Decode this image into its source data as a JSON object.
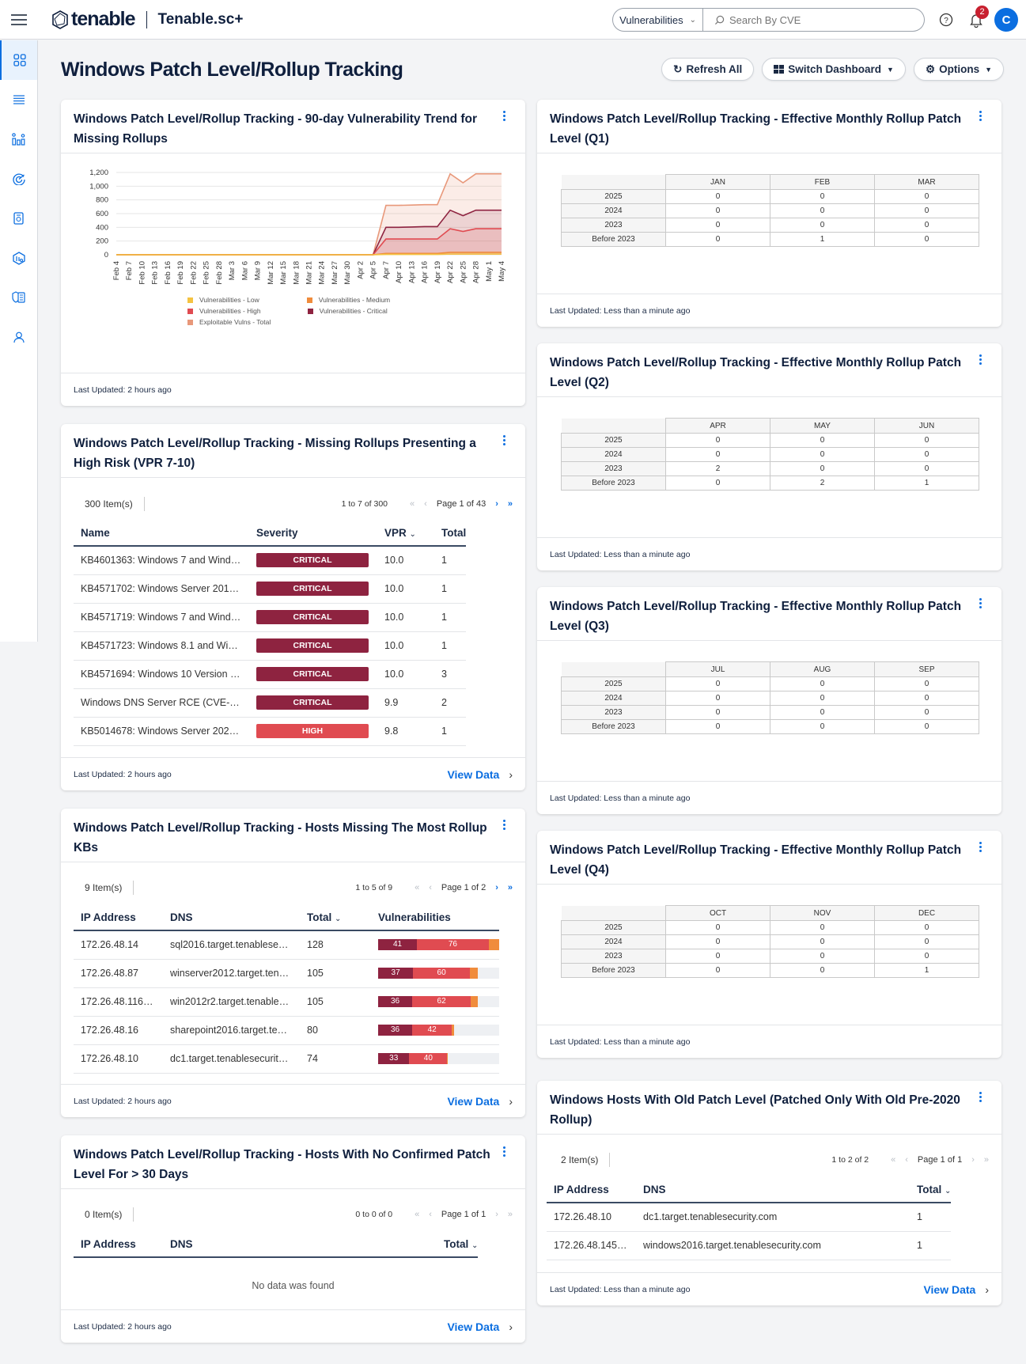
{
  "topbar": {
    "brand": "tenable",
    "app_name": "Tenable.sc+",
    "context_select": "Vulnerabilities",
    "search_placeholder": "Search By CVE",
    "notification_count": "2",
    "user_initial": "C"
  },
  "sidebar": {
    "items": [
      {
        "icon": "dashboard-grid-icon",
        "active": true
      },
      {
        "icon": "list-icon"
      },
      {
        "icon": "analytics-icon"
      },
      {
        "icon": "scan-target-icon"
      },
      {
        "icon": "report-icon"
      },
      {
        "icon": "assets-icon"
      },
      {
        "icon": "policy-shield-icon"
      },
      {
        "icon": "user-icon"
      }
    ]
  },
  "page": {
    "title": "Windows Patch Level/Rollup Tracking",
    "buttons": {
      "refresh": "Refresh All",
      "switch": "Switch Dashboard",
      "options": "Options"
    }
  },
  "trend_card": {
    "title": "Windows Patch Level/Rollup Tracking - 90-day Vulnerability Trend for Missing Rollups",
    "footer": "Last Updated: 2 hours ago"
  },
  "chart_data": {
    "type": "area",
    "title": "Windows Patch Level/Rollup Tracking - 90-day Vulnerability Trend for Missing Rollups",
    "xlabel": "",
    "ylabel": "",
    "ylim": [
      0,
      1200
    ],
    "yticks": [
      "0",
      "200",
      "400",
      "600",
      "800",
      "1,000",
      "1,200"
    ],
    "ytick_values": [
      0,
      200,
      400,
      600,
      800,
      1000,
      1200
    ],
    "x": [
      "Feb 4",
      "Feb 7",
      "Feb 10",
      "Feb 13",
      "Feb 16",
      "Feb 19",
      "Feb 22",
      "Feb 25",
      "Feb 28",
      "Mar 3",
      "Mar 6",
      "Mar 9",
      "Mar 12",
      "Mar 15",
      "Mar 18",
      "Mar 21",
      "Mar 24",
      "Mar 27",
      "Mar 30",
      "Apr 2",
      "Apr 5",
      "Apr 7",
      "Apr 10",
      "Apr 13",
      "Apr 16",
      "Apr 19",
      "Apr 22",
      "Apr 25",
      "Apr 28",
      "May 1",
      "May 4"
    ],
    "grid": true,
    "legend_position": "bottom",
    "series": [
      {
        "name": "Vulnerabilities - Low",
        "color": "#f5c342",
        "values": [
          0,
          0,
          0,
          0,
          0,
          0,
          0,
          0,
          0,
          0,
          0,
          0,
          0,
          0,
          0,
          0,
          0,
          0,
          0,
          0,
          0,
          5,
          5,
          5,
          5,
          5,
          10,
          10,
          10,
          10,
          10
        ]
      },
      {
        "name": "Vulnerabilities - Medium",
        "color": "#f08c3c",
        "values": [
          0,
          0,
          0,
          0,
          0,
          0,
          0,
          0,
          0,
          0,
          0,
          0,
          0,
          0,
          0,
          0,
          0,
          0,
          0,
          0,
          0,
          20,
          20,
          20,
          20,
          20,
          35,
          35,
          35,
          35,
          35
        ]
      },
      {
        "name": "Vulnerabilities - High",
        "color": "#e04b51",
        "values": [
          0,
          0,
          0,
          0,
          0,
          0,
          0,
          0,
          0,
          0,
          0,
          0,
          0,
          0,
          0,
          0,
          0,
          0,
          0,
          0,
          0,
          230,
          230,
          230,
          230,
          230,
          380,
          340,
          380,
          380,
          380
        ]
      },
      {
        "name": "Vulnerabilities - Critical",
        "color": "#8e2340",
        "values": [
          0,
          0,
          0,
          0,
          0,
          0,
          0,
          0,
          0,
          0,
          0,
          0,
          0,
          0,
          0,
          0,
          0,
          0,
          0,
          0,
          0,
          400,
          400,
          405,
          410,
          410,
          650,
          570,
          650,
          650,
          650
        ]
      },
      {
        "name": "Exploitable Vulns - Total",
        "color": "#e8987a",
        "values": [
          0,
          0,
          0,
          0,
          0,
          0,
          0,
          0,
          0,
          0,
          0,
          0,
          0,
          0,
          0,
          0,
          0,
          0,
          0,
          0,
          0,
          720,
          720,
          725,
          730,
          730,
          1180,
          1050,
          1180,
          1180,
          1180
        ]
      }
    ]
  },
  "missing_rollups": {
    "title": "Windows Patch Level/Rollup Tracking - Missing Rollups Presenting a High Risk (VPR 7-10)",
    "items": "300 Item(s)",
    "range": "1 to 7 of 300",
    "page": "Page 1 of 43",
    "columns": [
      "Name",
      "Severity",
      "VPR",
      "Total"
    ],
    "rows": [
      {
        "name": "KB4601363: Windows 7 and Wind…",
        "severity": "CRITICAL",
        "vpr": "10.0",
        "total": "1"
      },
      {
        "name": "KB4571702: Windows Server 201…",
        "severity": "CRITICAL",
        "vpr": "10.0",
        "total": "1"
      },
      {
        "name": "KB4571719: Windows 7 and Wind…",
        "severity": "CRITICAL",
        "vpr": "10.0",
        "total": "1"
      },
      {
        "name": "KB4571723: Windows 8.1 and Wi…",
        "severity": "CRITICAL",
        "vpr": "10.0",
        "total": "1"
      },
      {
        "name": "KB4571694: Windows 10 Version …",
        "severity": "CRITICAL",
        "vpr": "10.0",
        "total": "3"
      },
      {
        "name": "Windows DNS Server RCE (CVE-…",
        "severity": "CRITICAL",
        "vpr": "9.9",
        "total": "2"
      },
      {
        "name": "KB5014678: Windows Server 202…",
        "severity": "HIGH",
        "vpr": "9.8",
        "total": "1"
      }
    ],
    "footer": "Last Updated: 2 hours ago",
    "view_data": "View Data"
  },
  "severity_colors": {
    "CRITICAL": "#8e2340",
    "HIGH": "#e04b51",
    "MEDIUM": "#f08c3c",
    "LOW": "#f5c342"
  },
  "hosts_missing": {
    "title": "Windows Patch Level/Rollup Tracking - Hosts Missing The Most Rollup KBs",
    "items": "9 Item(s)",
    "range": "1 to 5 of 9",
    "page": "Page 1 of 2",
    "columns": [
      "IP Address",
      "DNS",
      "Total",
      "Vulnerabilities"
    ],
    "rows": [
      {
        "ip": "172.26.48.14",
        "dns": "sql2016.target.tenablese…",
        "total": "128",
        "critical": 41,
        "high": 76,
        "medium": 11,
        "low": 0
      },
      {
        "ip": "172.26.48.87",
        "dns": "winserver2012.target.ten…",
        "total": "105",
        "critical": 37,
        "high": 60,
        "medium": 8,
        "low": 0
      },
      {
        "ip": "172.26.48.116…",
        "dns": "win2012r2.target.tenable…",
        "total": "105",
        "critical": 36,
        "high": 62,
        "medium": 7,
        "low": 0
      },
      {
        "ip": "172.26.48.16",
        "dns": "sharepoint2016.target.te…",
        "total": "80",
        "critical": 36,
        "high": 42,
        "medium": 2,
        "low": 0
      },
      {
        "ip": "172.26.48.10",
        "dns": "dc1.target.tenablesecurit…",
        "total": "74",
        "critical": 33,
        "high": 40,
        "medium": 1,
        "low": 0
      }
    ],
    "footer": "Last Updated: 2 hours ago",
    "view_data": "View Data"
  },
  "no_patch": {
    "title": "Windows Patch Level/Rollup Tracking - Hosts With No Confirmed Patch Level For > 30 Days",
    "items": "0 Item(s)",
    "range": "0 to 0 of 0",
    "page": "Page 1 of 1",
    "columns": [
      "IP Address",
      "DNS",
      "Total"
    ],
    "empty": "No data was found",
    "footer": "Last Updated: 2 hours ago",
    "view_data": "View Data"
  },
  "monthly": [
    {
      "title": "Windows Patch Level/Rollup Tracking - Effective Monthly Rollup Patch Level (Q1)",
      "months": [
        "JAN",
        "FEB",
        "MAR"
      ],
      "rows": [
        {
          "label": "2025",
          "v": [
            "0",
            "0",
            "0"
          ]
        },
        {
          "label": "2024",
          "v": [
            "0",
            "0",
            "0"
          ]
        },
        {
          "label": "2023",
          "v": [
            "0",
            "0",
            "0"
          ]
        },
        {
          "label": "Before 2023",
          "v": [
            "0",
            "1",
            "0"
          ]
        }
      ],
      "footer": "Last Updated: Less than a minute ago"
    },
    {
      "title": "Windows Patch Level/Rollup Tracking - Effective Monthly Rollup Patch Level (Q2)",
      "months": [
        "APR",
        "MAY",
        "JUN"
      ],
      "rows": [
        {
          "label": "2025",
          "v": [
            "0",
            "0",
            "0"
          ]
        },
        {
          "label": "2024",
          "v": [
            "0",
            "0",
            "0"
          ]
        },
        {
          "label": "2023",
          "v": [
            "2",
            "0",
            "0"
          ]
        },
        {
          "label": "Before 2023",
          "v": [
            "0",
            "2",
            "1"
          ]
        }
      ],
      "footer": "Last Updated: Less than a minute ago"
    },
    {
      "title": "Windows Patch Level/Rollup Tracking - Effective Monthly Rollup Patch Level (Q3)",
      "months": [
        "JUL",
        "AUG",
        "SEP"
      ],
      "rows": [
        {
          "label": "2025",
          "v": [
            "0",
            "0",
            "0"
          ]
        },
        {
          "label": "2024",
          "v": [
            "0",
            "0",
            "0"
          ]
        },
        {
          "label": "2023",
          "v": [
            "0",
            "0",
            "0"
          ]
        },
        {
          "label": "Before 2023",
          "v": [
            "0",
            "0",
            "0"
          ]
        }
      ],
      "footer": "Last Updated: Less than a minute ago"
    },
    {
      "title": "Windows Patch Level/Rollup Tracking - Effective Monthly Rollup Patch Level (Q4)",
      "months": [
        "OCT",
        "NOV",
        "DEC"
      ],
      "rows": [
        {
          "label": "2025",
          "v": [
            "0",
            "0",
            "0"
          ]
        },
        {
          "label": "2024",
          "v": [
            "0",
            "0",
            "0"
          ]
        },
        {
          "label": "2023",
          "v": [
            "0",
            "0",
            "0"
          ]
        },
        {
          "label": "Before 2023",
          "v": [
            "0",
            "0",
            "1"
          ]
        }
      ],
      "footer": "Last Updated: Less than a minute ago"
    }
  ],
  "old_patch": {
    "title": "Windows Hosts With Old Patch Level (Patched Only With Old Pre-2020 Rollup)",
    "items": "2 Item(s)",
    "range": "1 to 2 of 2",
    "page": "Page 1 of 1",
    "columns": [
      "IP Address",
      "DNS",
      "Total"
    ],
    "rows": [
      {
        "ip": "172.26.48.10",
        "dns": "dc1.target.tenablesecurity.com",
        "total": "1"
      },
      {
        "ip": "172.26.48.145…",
        "dns": "windows2016.target.tenablesecurity.com",
        "total": "1"
      }
    ],
    "footer": "Last Updated: Less than a minute ago",
    "view_data": "View Data"
  }
}
